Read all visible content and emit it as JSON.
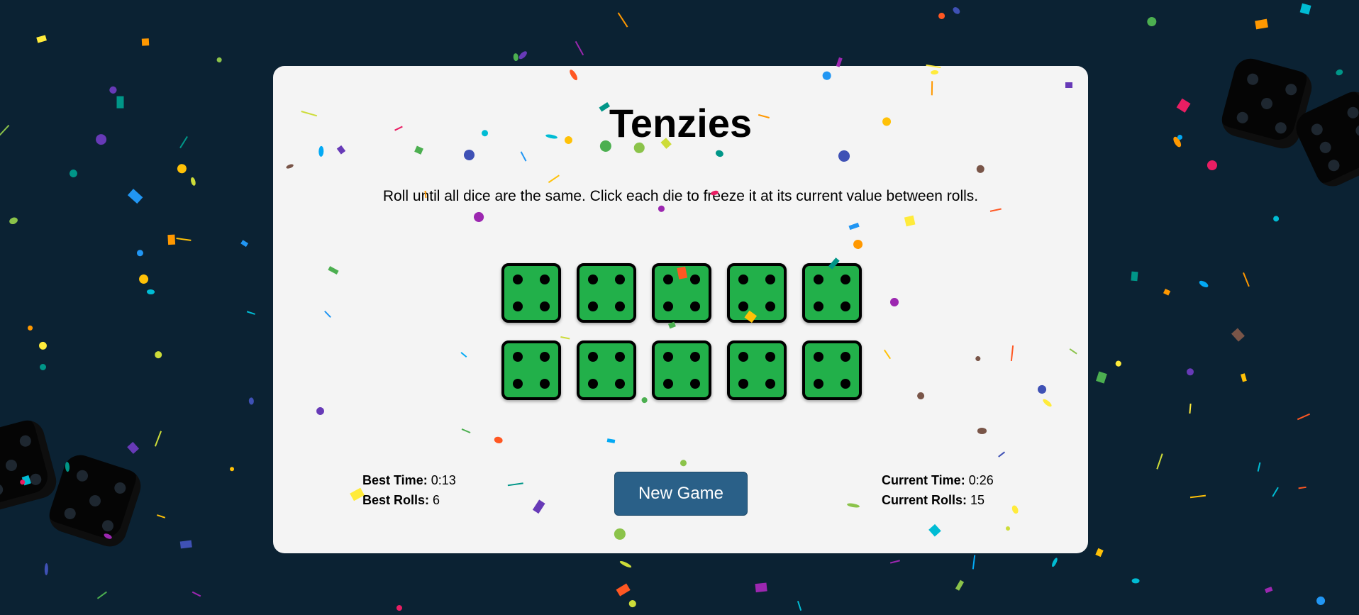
{
  "game": {
    "title": "Tenzies",
    "instructions": "Roll until all dice are the same. Click each die to freeze it at its current value between rolls.",
    "dice": [
      {
        "value": 4,
        "held": true
      },
      {
        "value": 4,
        "held": true
      },
      {
        "value": 4,
        "held": true
      },
      {
        "value": 4,
        "held": true
      },
      {
        "value": 4,
        "held": true
      },
      {
        "value": 4,
        "held": true
      },
      {
        "value": 4,
        "held": true
      },
      {
        "value": 4,
        "held": true
      },
      {
        "value": 4,
        "held": true
      },
      {
        "value": 4,
        "held": true
      }
    ],
    "best": {
      "time_label": "Best Time:",
      "time_value": "0:13",
      "rolls_label": "Best Rolls:",
      "rolls_value": "6"
    },
    "current": {
      "time_label": "Current Time:",
      "time_value": "0:26",
      "rolls_label": "Current Rolls:",
      "rolls_value": "15"
    },
    "new_game_label": "New Game"
  },
  "colors": {
    "background": "#0b2233",
    "card": "#f4f4f4",
    "die_held": "#22b04a",
    "button": "#2a6088"
  },
  "confetti_colors": [
    "#e91e63",
    "#9c27b0",
    "#673ab7",
    "#3f51b5",
    "#2196f3",
    "#03a9f4",
    "#00bcd4",
    "#009688",
    "#4caf50",
    "#8bc34a",
    "#cddc39",
    "#ffeb3b",
    "#ffc107",
    "#ff9800",
    "#ff5722",
    "#795548"
  ]
}
